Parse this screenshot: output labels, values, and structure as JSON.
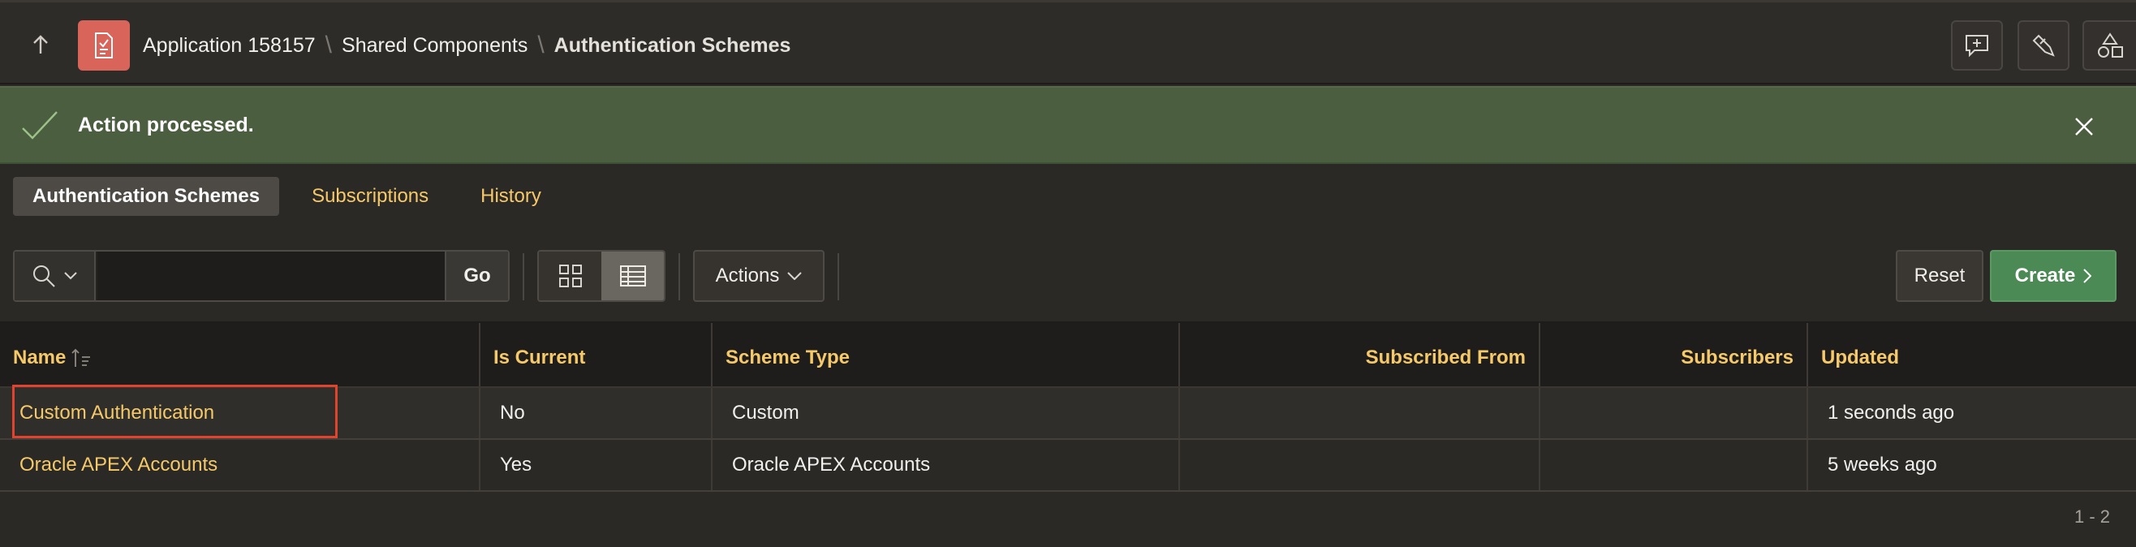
{
  "header": {
    "breadcrumb": [
      "Application 158157",
      "Shared Components",
      "Authentication Schemes"
    ],
    "icons": [
      "up-arrow-icon",
      "app-icon",
      "feedback-icon",
      "pen-icon",
      "shapes-icon"
    ]
  },
  "alert": {
    "message": "Action processed."
  },
  "tabs": [
    "Authentication Schemes",
    "Subscriptions",
    "History"
  ],
  "toolbar": {
    "search_placeholder": "",
    "go_label": "Go",
    "actions_label": "Actions",
    "reset_label": "Reset",
    "create_label": "Create"
  },
  "table": {
    "columns": [
      "Name",
      "Is Current",
      "Scheme Type",
      "Subscribed From",
      "Subscribers",
      "Updated"
    ],
    "rows": [
      [
        "Custom Authentication",
        "No",
        "Custom",
        "",
        "",
        "1 seconds ago"
      ],
      [
        "Oracle APEX Accounts",
        "Yes",
        "Oracle APEX Accounts",
        "",
        "",
        "5 weeks ago"
      ]
    ]
  },
  "pagination": "1 - 2",
  "colors": {
    "accent": "#f5c96a",
    "alert_bg": "#4b5e3f",
    "create_bg": "#4b8a55",
    "highlight": "#e2432e"
  }
}
